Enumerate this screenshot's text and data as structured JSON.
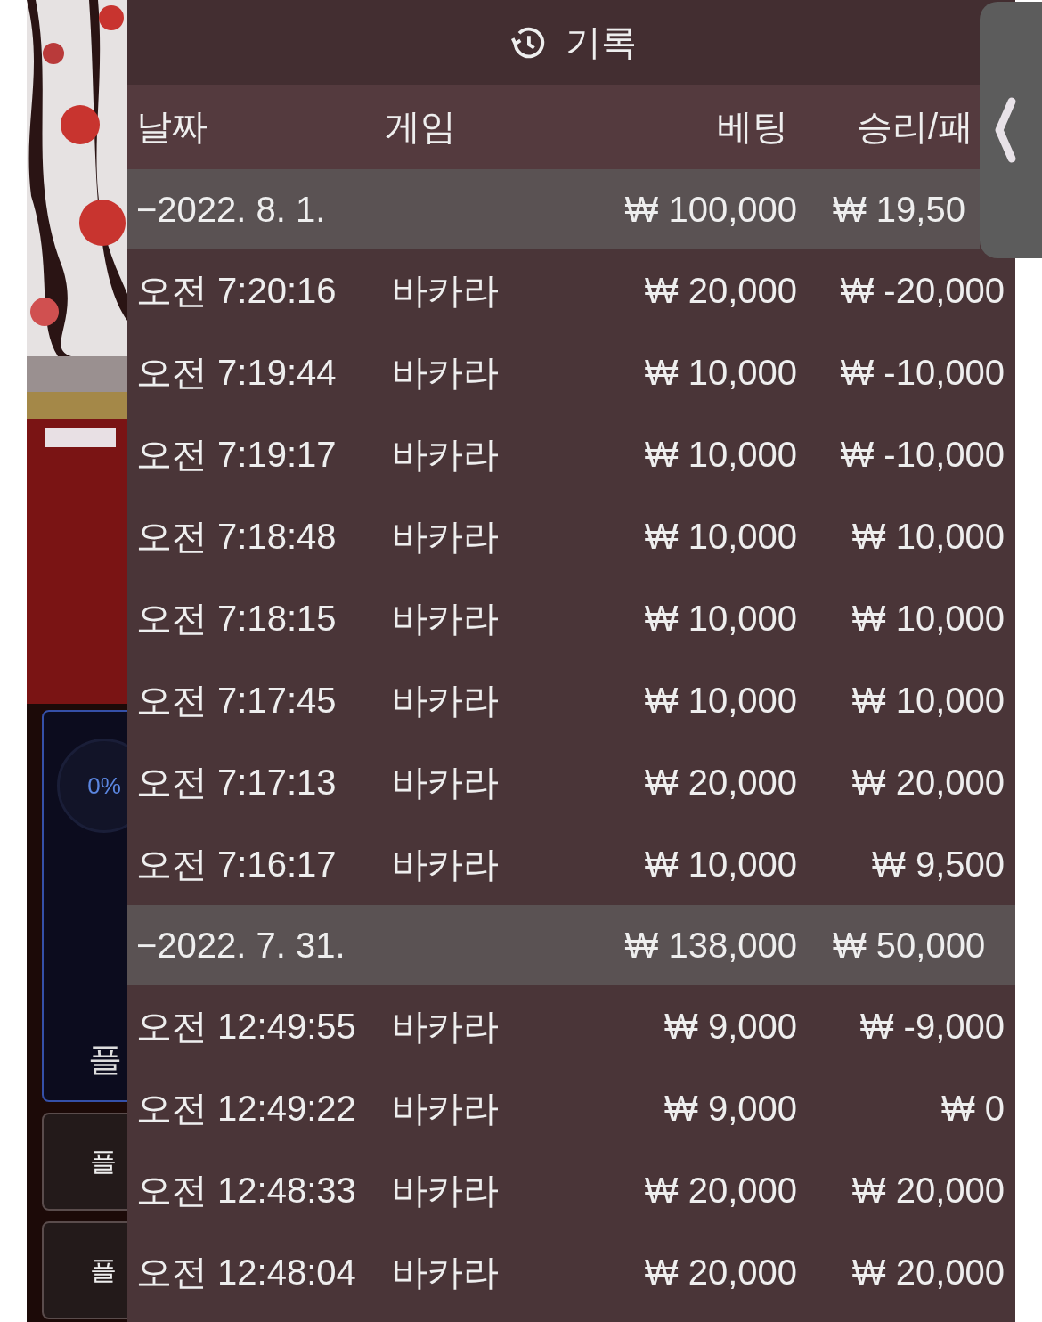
{
  "side_panel": {
    "progress_label": "0%",
    "card_label": "플",
    "buttons": [
      "플",
      "플"
    ]
  },
  "history": {
    "title": "기록",
    "columns": [
      "날짜",
      "게임",
      "베팅",
      "승리/패"
    ],
    "groups": [
      {
        "date": "−2022. 8. 1.",
        "bet": "₩ 100,000",
        "result": "₩ 19,50",
        "rows": [
          {
            "time": "오전 7:20:16",
            "game": "바카라",
            "bet": "₩ 20,000",
            "result": "₩ -20,000"
          },
          {
            "time": "오전 7:19:44",
            "game": "바카라",
            "bet": "₩ 10,000",
            "result": "₩ -10,000"
          },
          {
            "time": "오전 7:19:17",
            "game": "바카라",
            "bet": "₩ 10,000",
            "result": "₩ -10,000"
          },
          {
            "time": "오전 7:18:48",
            "game": "바카라",
            "bet": "₩ 10,000",
            "result": "₩ 10,000"
          },
          {
            "time": "오전 7:18:15",
            "game": "바카라",
            "bet": "₩ 10,000",
            "result": "₩ 10,000"
          },
          {
            "time": "오전 7:17:45",
            "game": "바카라",
            "bet": "₩ 10,000",
            "result": "₩ 10,000"
          },
          {
            "time": "오전 7:17:13",
            "game": "바카라",
            "bet": "₩ 20,000",
            "result": "₩ 20,000"
          },
          {
            "time": "오전 7:16:17",
            "game": "바카라",
            "bet": "₩ 10,000",
            "result": "₩ 9,500"
          }
        ]
      },
      {
        "date": "−2022. 7. 31.",
        "bet": "₩ 138,000",
        "result": "₩ 50,000",
        "rows": [
          {
            "time": "오전 12:49:55",
            "game": "바카라",
            "bet": "₩ 9,000",
            "result": "₩ -9,000"
          },
          {
            "time": "오전 12:49:22",
            "game": "바카라",
            "bet": "₩ 9,000",
            "result": "₩ 0"
          },
          {
            "time": "오전 12:48:33",
            "game": "바카라",
            "bet": "₩ 20,000",
            "result": "₩ 20,000"
          },
          {
            "time": "오전 12:48:04",
            "game": "바카라",
            "bet": "₩ 20,000",
            "result": "₩ 20,000"
          }
        ]
      }
    ]
  }
}
